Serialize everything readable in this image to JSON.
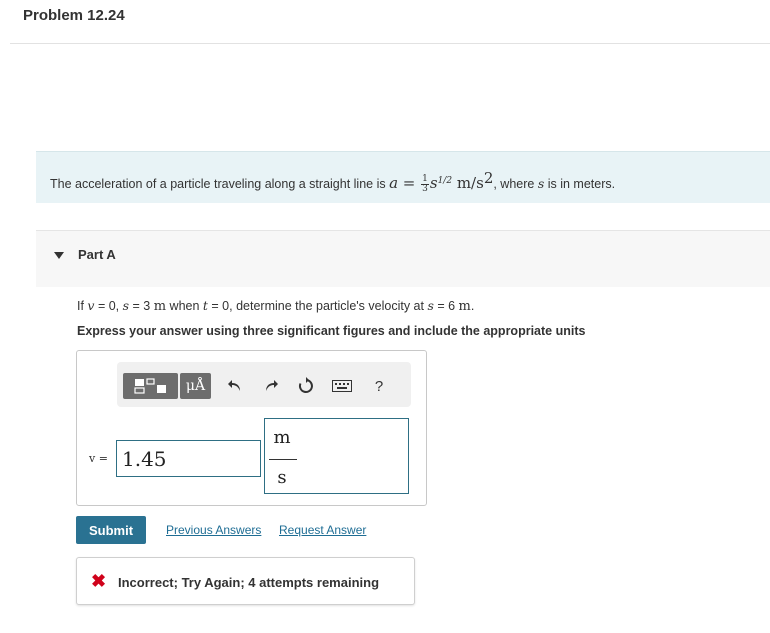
{
  "header": {
    "title": "Problem 12.24"
  },
  "statement": {
    "prefix": "The acceleration of a particle traveling along a straight line is ",
    "eq_var": "a",
    "eq_sign": " = ",
    "frac_num": "1",
    "frac_den": "3",
    "s_var": "s",
    "s_exp": "1/2",
    "units": " m/s",
    "units_exp": "2",
    "middle": ", where ",
    "s_var2": "s",
    "suffix": " is in meters."
  },
  "part": {
    "label": "Part A"
  },
  "question": {
    "text_1": "If ",
    "v": "v",
    "text_2": " = 0, ",
    "s": "s",
    "text_3": " = 3 ",
    "unit_m": "m",
    "text_4": " when ",
    "t": "t",
    "text_5": " = 0, determine the particle's velocity at ",
    "s2": "s",
    "text_6": " = 6 ",
    "unit_m2": "m",
    "text_7": "."
  },
  "instructions": "Express your answer using three significant figures and include the appropriate units",
  "toolbar": {
    "unit_label": "μÅ",
    "undo_icon": "undo-icon",
    "redo_icon": "redo-icon",
    "reset_icon": "reset-icon",
    "keyboard_icon": "keyboard-icon",
    "help_label": "?"
  },
  "answer": {
    "var_label": "v =",
    "value": "1.45",
    "unit_numerator": "m",
    "unit_denominator": "s"
  },
  "actions": {
    "submit": "Submit",
    "previous_answers": "Previous Answers",
    "request_answer": "Request Answer"
  },
  "feedback": {
    "icon": "x-icon",
    "color": "#d0021b",
    "text": "Incorrect; Try Again; 4 attempts remaining"
  },
  "colors": {
    "accent": "#2a7292",
    "link": "#1e6d94",
    "statement_bg": "#e8f3f6"
  }
}
